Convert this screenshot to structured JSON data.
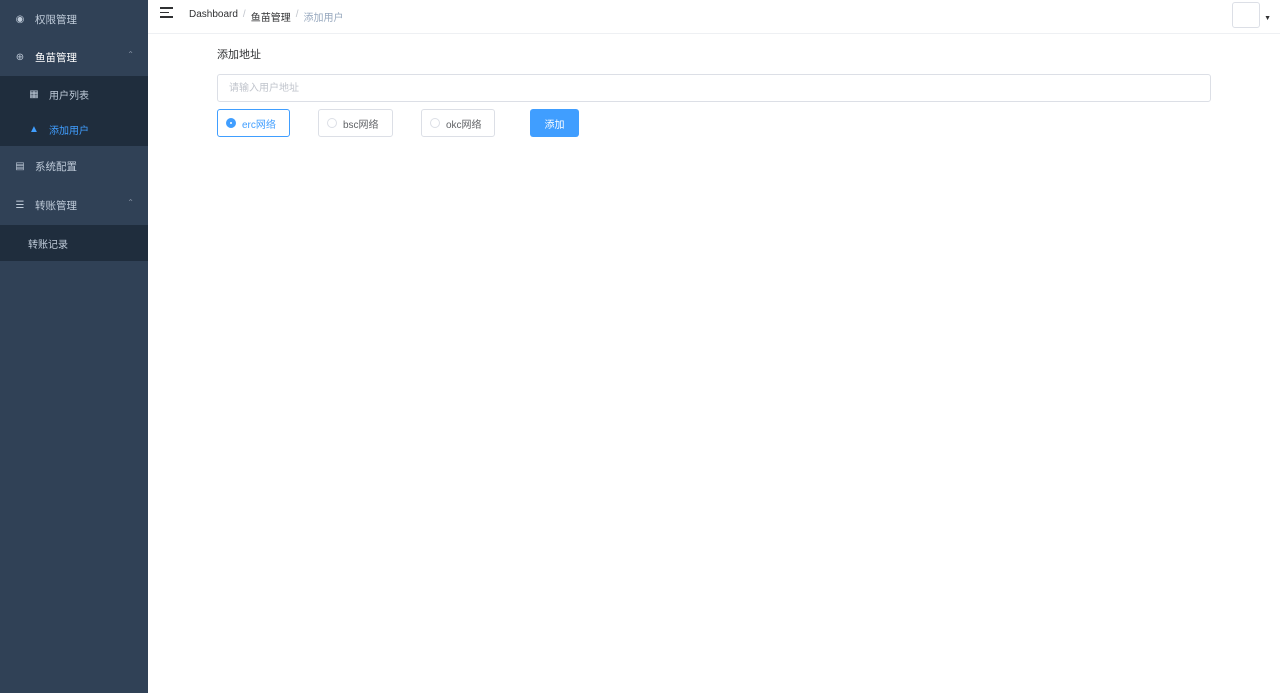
{
  "sidebar": {
    "items": [
      {
        "label": "权限管理",
        "icon": "dashboard-icon"
      },
      {
        "label": "鱼苗管理",
        "icon": "plus-circle-icon"
      },
      {
        "label": "系统配置",
        "icon": "config-icon"
      },
      {
        "label": "转账管理",
        "icon": "list-icon"
      }
    ],
    "fish_sub": [
      {
        "label": "用户列表",
        "icon": "table-icon"
      },
      {
        "label": "添加用户",
        "icon": "tree-icon"
      }
    ],
    "transfer_sub": [
      {
        "label": "转账记录"
      }
    ],
    "colors": {
      "bg": "#304156",
      "submenu_bg": "#1f2d3d",
      "active": "#409eff"
    }
  },
  "header": {
    "breadcrumb": [
      "Dashboard",
      "鱼苗管理",
      "添加用户"
    ],
    "separator": "/"
  },
  "form": {
    "title": "添加地址",
    "address_placeholder": "请输入用户地址",
    "networks": [
      {
        "label": "erc网络",
        "checked": true
      },
      {
        "label": "bsc网络",
        "checked": false
      },
      {
        "label": "okc网络",
        "checked": false
      }
    ],
    "submit_label": "添加"
  }
}
